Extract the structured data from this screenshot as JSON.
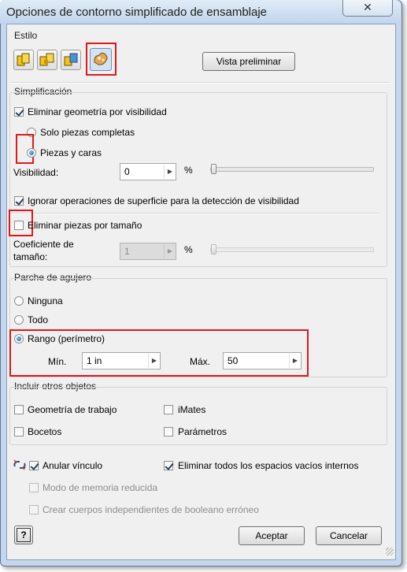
{
  "window": {
    "title": "Opciones de contorno simplificado de ensamblaje",
    "close_glyph": "✕"
  },
  "estilo": {
    "label": "Estilo",
    "icons": [
      "style-icon-1",
      "style-icon-2",
      "style-icon-3",
      "style-icon-4"
    ],
    "preview_button": "Vista preliminar"
  },
  "simplificacion": {
    "label": "Simplificación",
    "eliminar_visibilidad": {
      "label": "Eliminar geometría por visibilidad",
      "checked": true
    },
    "solo_piezas": "Solo piezas completas",
    "piezas_caras": "Piezas y caras",
    "visibilidad_label": "Visibilidad:",
    "visibilidad_value": "0",
    "visibilidad_unit": "%",
    "visibilidad_slider_pct": 0,
    "ignorar": {
      "label": "Ignorar operaciones de superficie para la detección de visibilidad",
      "checked": true
    },
    "eliminar_tamano": {
      "label": "Eliminar piezas por tamaño",
      "checked": false
    },
    "coef_label_1": "Coeficiente de",
    "coef_label_2": "tamaño:",
    "coef_value": "1",
    "coef_unit": "%"
  },
  "parche": {
    "label": "Parche de agujero",
    "ninguna": "Ninguna",
    "todo": "Todo",
    "rango": "Rango (perímetro)",
    "min_label": "Mín.",
    "min_value": "1 in",
    "max_label": "Máx.",
    "max_value": "50"
  },
  "incluir": {
    "label": "Incluir otros objetos",
    "geometria": "Geometría de trabajo",
    "imates": "iMates",
    "bocetos": "Bocetos",
    "parametros": "Parámetros"
  },
  "opciones": {
    "link_icon": "break-link-icon",
    "anular": "Anular vínculo",
    "eliminar_vacios": "Eliminar todos los espacios vacíos internos",
    "memoria": "Modo de memoria reducida",
    "crear_cuerpos": "Crear cuerpos independientes de booleano erróneo"
  },
  "footer": {
    "help_glyph": "?",
    "ok": "Aceptar",
    "cancel": "Cancelar"
  },
  "spin_glyph": "▶",
  "colors": {
    "highlight": "#e0181c",
    "window_frame": "#c5d7ec",
    "dialog_bg": "#f0f0f0"
  }
}
